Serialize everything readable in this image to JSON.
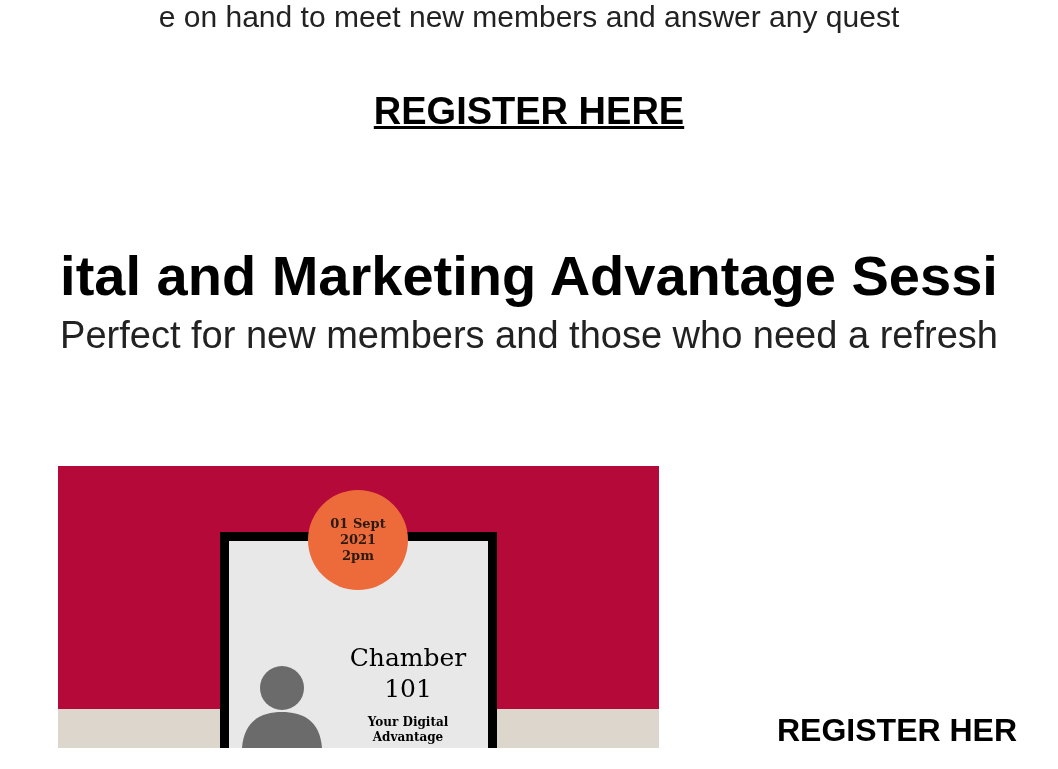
{
  "intro_text": "e on hand to meet new members and answer any quest",
  "register_link_top": "REGISTER HERE",
  "section": {
    "heading": "ital and Marketing Advantage Sessi",
    "subtitle": "Perfect for new members and those who need a refresh"
  },
  "poster": {
    "date_lines": [
      "01 Sept",
      "2021",
      "2pm"
    ],
    "title_lines": [
      "Chamber",
      "101"
    ],
    "tagline_lines": [
      "Your Digital",
      "Advantage"
    ]
  },
  "register_link_side": "REGISTER HER"
}
